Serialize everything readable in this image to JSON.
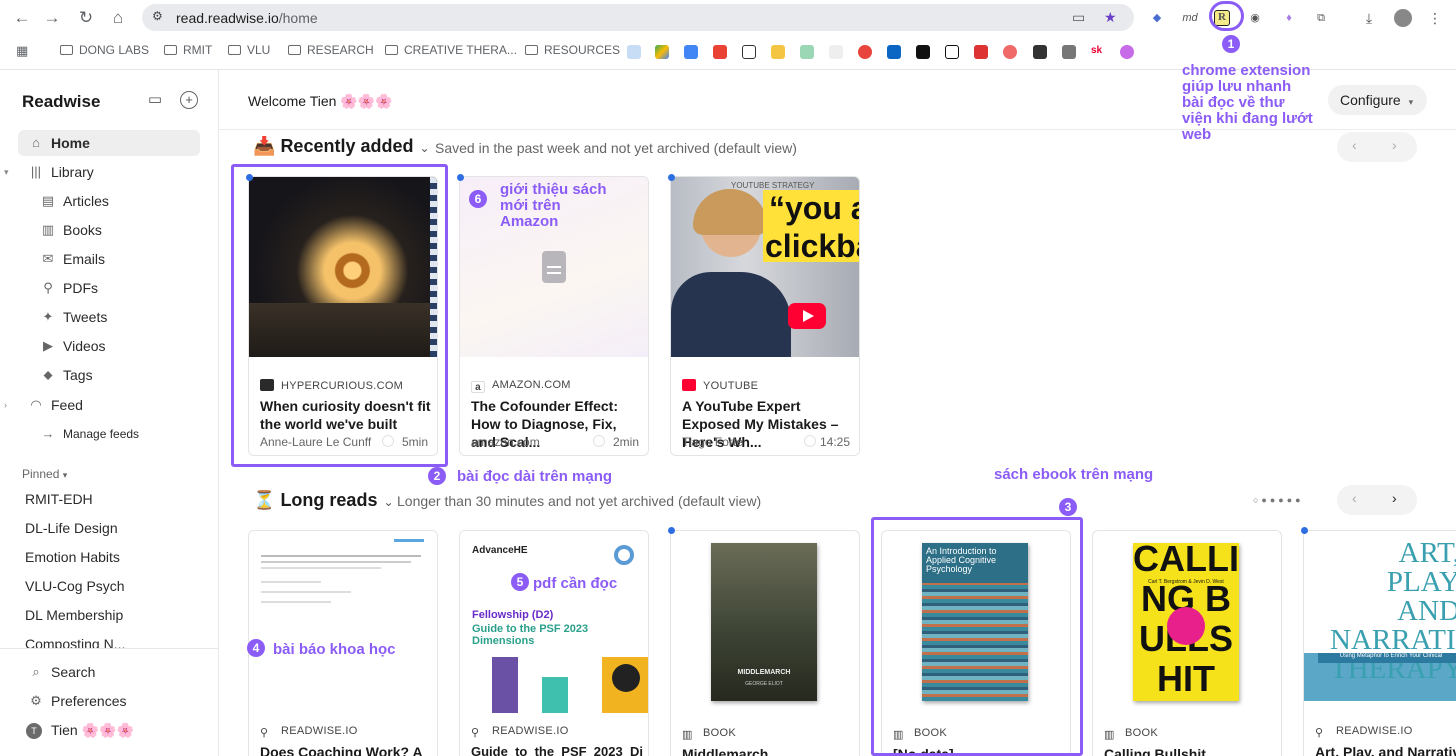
{
  "browser": {
    "url_host": "read.readwise.io",
    "url_path": "/home",
    "bookmarks": [
      "DONG LABS",
      "RMIT",
      "VLU",
      "RESEARCH",
      "CREATIVE THERA...",
      "RESOURCES"
    ]
  },
  "sidebar": {
    "brand": "Readwise",
    "nav": [
      {
        "label": "Home",
        "icon": "home-icon"
      },
      {
        "label": "Library",
        "icon": "library-icon"
      },
      {
        "label": "Articles",
        "icon": "article-icon"
      },
      {
        "label": "Books",
        "icon": "book-icon"
      },
      {
        "label": "Emails",
        "icon": "email-icon"
      },
      {
        "label": "PDFs",
        "icon": "pdf-icon"
      },
      {
        "label": "Tweets",
        "icon": "tweet-icon"
      },
      {
        "label": "Videos",
        "icon": "video-icon"
      },
      {
        "label": "Tags",
        "icon": "tag-icon"
      },
      {
        "label": "Feed",
        "icon": "feed-icon"
      },
      {
        "label": "Manage feeds",
        "icon": "arrow-right-icon"
      }
    ],
    "pinned_heading": "Pinned",
    "pinned": [
      "RMIT-EDH",
      "DL-Life Design",
      "Emotion Habits",
      "VLU-Cog Psych",
      "DL Membership",
      "Composting N..."
    ],
    "bottom": {
      "search": "Search",
      "preferences": "Preferences",
      "user": "Tien 🌸🌸🌸",
      "avatar_initial": "T"
    }
  },
  "main": {
    "welcome": "Welcome Tien 🌸🌸🌸",
    "configure": "Configure",
    "recent": {
      "title": "Recently added",
      "emoji": "📥",
      "subtitle": "Saved in the past week and not yet archived (default view)",
      "cards": [
        {
          "source": "HYPERCURIOUS.COM",
          "title": "When curiosity doesn't fit the world we've built",
          "author": "Anne-Laure Le Cunff",
          "time": "5min"
        },
        {
          "source": "AMAZON.COM",
          "title": "The Cofounder Effect: How to Diagnose, Fix, and Scal...",
          "author": "amazon.com",
          "time": "2min"
        },
        {
          "source": "YOUTUBE",
          "title": "A YouTube Expert Exposed My Mistakes – Here's Wh...",
          "author": "Tiago Forte",
          "time": "14:25",
          "thumb_text_1": "“you a",
          "thumb_text_2": "clickba",
          "thumb_caption": "YOUTUBE STRATEGY"
        }
      ]
    },
    "long": {
      "title": "Long reads",
      "emoji": "⏳",
      "subtitle": "Longer than 30 minutes and not yet archived (default view)",
      "cards": [
        {
          "source": "READWISE.IO",
          "title": "Does Coaching Work? A"
        },
        {
          "source": "READWISE.IO",
          "title": "Guide_to_the_PSF_2023_Di",
          "thumb_brand": "AdvanceHE",
          "thumb_heading": "Fellowship (D2)",
          "thumb_sub": "Guide to the PSF 2023 Dimensions"
        },
        {
          "source": "BOOK",
          "title": "Middlemarch",
          "cover_title": "MIDDLEMARCH",
          "cover_author": "GEORGE ELIOT"
        },
        {
          "source": "BOOK",
          "title": "[No data]",
          "cover_title": "An Introduction to Applied Cognitive Psychology"
        },
        {
          "source": "BOOK",
          "title": "Calling Bullshit",
          "cover_title": "CALLING BULLSHIT",
          "cover_authors": "Carl T. Bergstrom & Jevin D. West"
        },
        {
          "source": "READWISE.IO",
          "title": "Art, Play, and Narrativ",
          "cover_title": "ART, PLAY AND NARRATIVE THERAPY",
          "cover_sub": "Using Metaphor to Enrich Your Clinical"
        }
      ]
    }
  },
  "annotations": {
    "n1": "chrome extension giúp lưu nhanh bài đọc về thư viện khi đang lướt web",
    "n2": "bài đọc dài trên mạng",
    "n3": "sách ebook trên mạng",
    "n4": "bài báo khoa học",
    "n5": "pdf cần đọc",
    "n6": "giới thiệu sách mới trên Amazon"
  },
  "colors": {
    "accent": "#8b5cf6",
    "new_dot": "#2d6fe3"
  }
}
